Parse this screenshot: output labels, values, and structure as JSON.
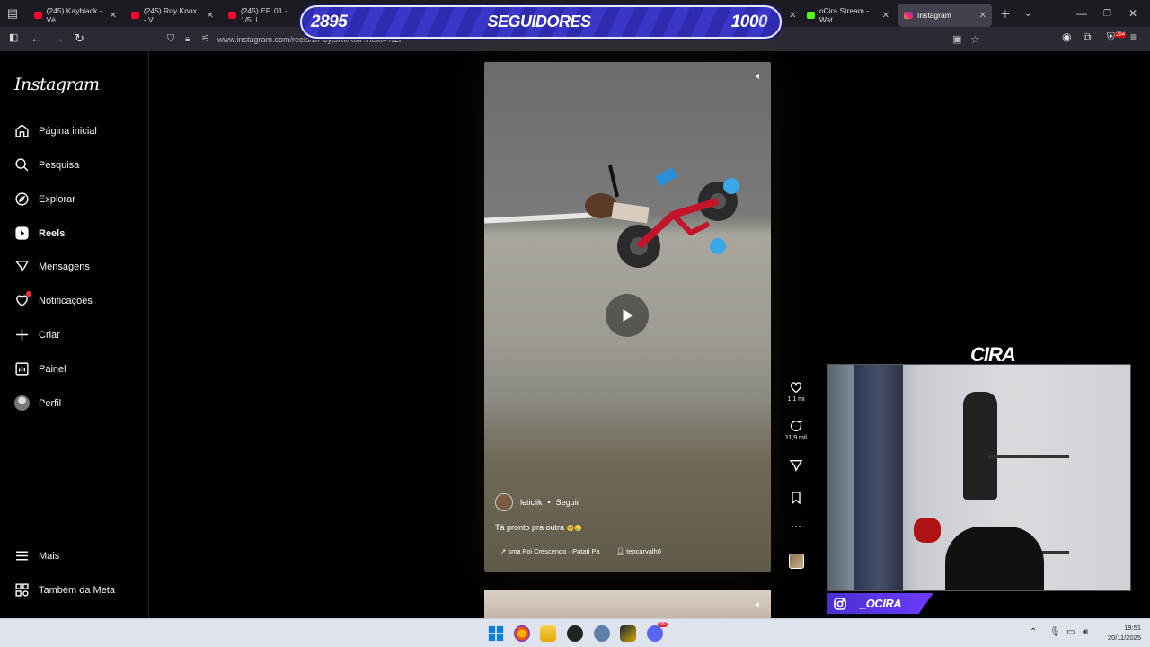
{
  "browser": {
    "tabs": [
      {
        "label": "(245) Kayblack - Vé",
        "favicon": "youtube-icon",
        "color": "#ff0033"
      },
      {
        "label": "(245) Roy Knox - V",
        "favicon": "youtube-icon",
        "color": "#ff0033"
      },
      {
        "label": "(245) EP. 01 - 1/5: l",
        "favicon": "youtube-icon",
        "color": "#ff0033"
      },
      {
        "label": "oCira Stream - Wat",
        "favicon": "kick-icon",
        "color": "#53fc18"
      },
      {
        "label": "Instagram",
        "favicon": "instagram-icon",
        "color": "#e1306c",
        "active": true
      }
    ],
    "url": "www.instagram.com/reels/DP3yj5RkR0I/?next=%2F",
    "extension_badge": "294"
  },
  "overlay_banner": {
    "left_count": "2895",
    "label": "SEGUIDORES",
    "right_count": "100",
    "right_suffix": "0"
  },
  "sidebar": {
    "logo": "Instagram",
    "items": [
      {
        "label": "Página inicial",
        "icon": "home-icon"
      },
      {
        "label": "Pesquisa",
        "icon": "search-icon"
      },
      {
        "label": "Explorar",
        "icon": "compass-icon"
      },
      {
        "label": "Reels",
        "icon": "reels-icon",
        "active": true
      },
      {
        "label": "Mensagens",
        "icon": "send-icon"
      },
      {
        "label": "Notificações",
        "icon": "heart-icon",
        "badge": true
      },
      {
        "label": "Criar",
        "icon": "plus-icon"
      },
      {
        "label": "Painel",
        "icon": "chart-icon"
      },
      {
        "label": "Perfil",
        "icon": "avatar-icon"
      }
    ],
    "bottom": [
      {
        "label": "Mais",
        "icon": "menu-icon"
      },
      {
        "label": "Também da Meta",
        "icon": "meta-icon"
      }
    ]
  },
  "reel": {
    "author": "leticiik",
    "follow": "Seguir",
    "separator": "•",
    "caption": "Tá pronto pra outra",
    "caption_emoji": "🥺🥲",
    "audio": "sma Foi Crescendo · Patati Pa",
    "tagged": "teocarvalh0"
  },
  "actions": {
    "likes": "1,1 mi",
    "comments": "11,9 mil"
  },
  "webcam": {
    "title": "CIRA",
    "handle": "_OCIRA"
  },
  "taskbar": {
    "time": "19:51",
    "date": "20/11/2025",
    "discord_badge": "99"
  }
}
